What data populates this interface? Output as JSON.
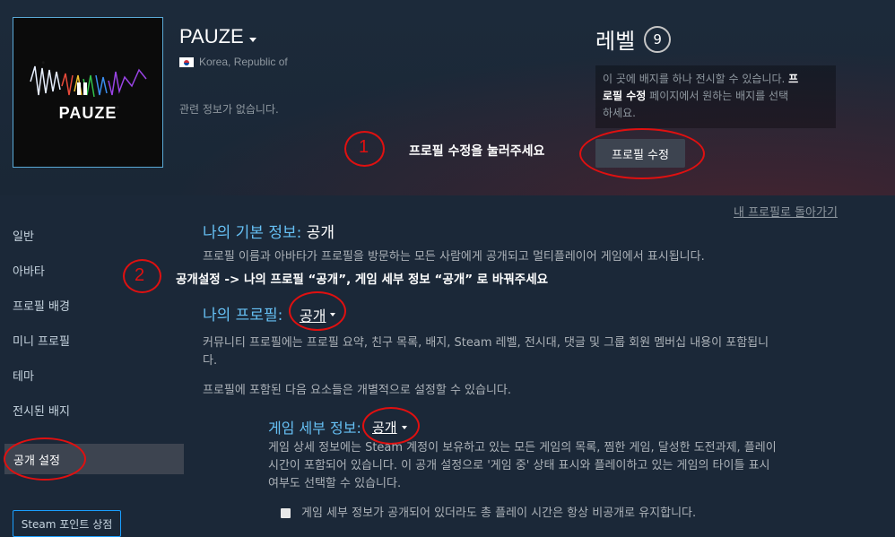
{
  "profile": {
    "name": "PAUZE",
    "avatar_text": "PAUZE",
    "country": "Korea, Republic of",
    "no_info": "관련 정보가 없습니다."
  },
  "level": {
    "label": "레벨",
    "value": "9"
  },
  "badge_box": {
    "line1_a": "이 곳에 배지를 하나 전시할 수 있습니다. ",
    "line1_b": "프",
    "line2_bold": "로필 수정",
    "line2_rest": " 페이지에서 원하는 배지를 선택",
    "line3": "하세요."
  },
  "edit_profile_button": "프로필 수정",
  "annotations": {
    "step1_number": "1",
    "step1_text": "프로필 수정을 눌러주세요",
    "step2_number": "2",
    "step2_text": "공개설정 -> 나의 프로필 “공개”, 게임 세부 정보 “공개” 로 바꿔주세요"
  },
  "sidebar": {
    "items": [
      "일반",
      "아바타",
      "프로필 배경",
      "미니 프로필",
      "테마",
      "전시된 배지"
    ],
    "active": "공개 설정",
    "points_button": "Steam 포인트 상점"
  },
  "back_link": "내 프로필로 돌아가기",
  "basic_info": {
    "title": "나의 기본 정보:",
    "value": "공개",
    "description": "프로필 이름과 아바타가 프로필을 방문하는 모든 사람에게 공개되고 멀티플레이어 게임에서 표시됩니다."
  },
  "my_profile": {
    "title": "나의 프로필:",
    "value": "공개",
    "description_line1": "커뮤니티 프로필에는 프로필 요약, 친구 목록, 배지, Steam 레벨, 전시대, 댓글 및 그룹 회원 멤버십 내용이 포함됩니",
    "description_line2": "다.",
    "individual": "프로필에 포함된 다음 요소들은 개별적으로 설정할 수 있습니다."
  },
  "game_details": {
    "title": "게임 세부 정보:",
    "value": "공개",
    "line1": "게임 상세 정보에는 Steam 계정이 보유하고 있는 모든 게임의 목록, 찜한 게임, 달성한 도전과제, 플레이",
    "line2": "시간이 포함되어 있습니다. 이 공개 설정으로 '게임 중' 상태 표시와 플레이하고 있는 게임의 타이틀 표시",
    "line3": "여부도 선택할 수 있습니다.",
    "checkbox_label": "게임 세부 정보가 공개되어 있더라도 총 플레이 시간은 항상 비공개로 유지합니다.",
    "checkbox_checked": false
  },
  "colors": {
    "background": "#1b2838",
    "accent_blue": "#66c0f4",
    "annotation_red": "#e01010",
    "button_gray": "#3d4450"
  }
}
